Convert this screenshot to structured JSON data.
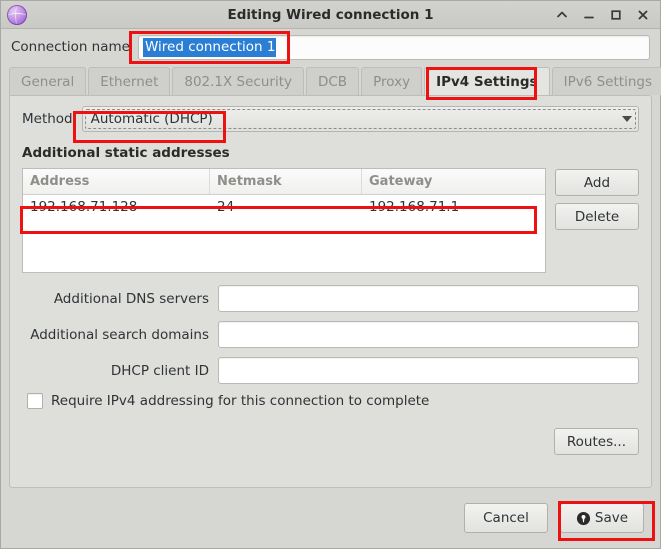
{
  "window": {
    "title": "Editing Wired connection 1",
    "icon": "network-globe-icon",
    "controls": {
      "shade": "shade-window-button",
      "minimize": "minimize-window-button",
      "maximize": "maximize-window-button",
      "close": "close-window-button"
    }
  },
  "connection": {
    "label": "Connection name",
    "value": "Wired connection 1",
    "placeholder": "",
    "selected": true
  },
  "tabs": [
    {
      "label": "General",
      "active": false
    },
    {
      "label": "Ethernet",
      "active": false
    },
    {
      "label": "802.1X Security",
      "active": false
    },
    {
      "label": "DCB",
      "active": false
    },
    {
      "label": "Proxy",
      "active": false
    },
    {
      "label": "IPv4 Settings",
      "active": true
    },
    {
      "label": "IPv6 Settings",
      "active": false
    }
  ],
  "ipv4": {
    "method": {
      "label": "Method",
      "value": "Automatic (DHCP)"
    },
    "static_addresses": {
      "title": "Additional static addresses",
      "columns": [
        "Address",
        "Netmask",
        "Gateway"
      ],
      "rows": [
        [
          "192.168.71.128",
          "24",
          "192.168.71.1"
        ]
      ],
      "add_label": "Add",
      "delete_label": "Delete"
    },
    "fields": [
      {
        "label": "Additional DNS servers",
        "value": "",
        "placeholder": ""
      },
      {
        "label": "Additional search domains",
        "value": "",
        "placeholder": ""
      },
      {
        "label": "DHCP client ID",
        "value": "",
        "placeholder": ""
      }
    ],
    "require_ipv4": {
      "label": "Require IPv4 addressing for this connection to complete",
      "checked": false
    },
    "routes_label": "Routes..."
  },
  "footer": {
    "cancel_label": "Cancel",
    "save_label": "Save",
    "save_icon": "authentication-lock-icon"
  },
  "colors": {
    "annotation": "#ee1111",
    "selection": "#2a7fd4",
    "window_bg": "#d6d6d3",
    "panel_bg": "#dededb",
    "accent_icon": "#a96fd8"
  }
}
